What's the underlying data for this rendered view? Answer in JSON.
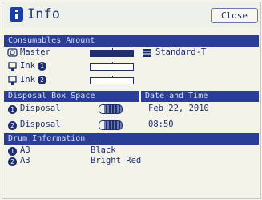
{
  "header": {
    "title": "Info",
    "close_label": "Close"
  },
  "consumables": {
    "section_label": "Consumables Amount",
    "master": {
      "label": "Master",
      "level": 1.0,
      "type_label": "Standard-T"
    },
    "ink1": {
      "label": "Ink",
      "number": "1",
      "level": 0.0
    },
    "ink2": {
      "label": "Ink",
      "number": "2",
      "level": 0.0
    }
  },
  "disposal": {
    "section_label": "Disposal Box Space",
    "rows": [
      {
        "number": "1",
        "label": "Disposal",
        "fill": 0.8
      },
      {
        "number": "2",
        "label": "Disposal",
        "fill": 0.8
      }
    ]
  },
  "datetime": {
    "section_label": "Date and Time",
    "date": "Feb 22, 2010",
    "time": "08:50"
  },
  "drum": {
    "section_label": "Drum Information",
    "rows": [
      {
        "number": "1",
        "size": "A3",
        "color": "Black"
      },
      {
        "number": "2",
        "size": "A3",
        "color": "Bright Red"
      }
    ]
  },
  "colors": {
    "bar": "#2a3e96",
    "text": "#1f2f6e",
    "background": "#f3f3ea"
  },
  "icons": [
    "info-icon",
    "master-icon",
    "ink-icon",
    "disposal-icon",
    "drum-icon"
  ]
}
